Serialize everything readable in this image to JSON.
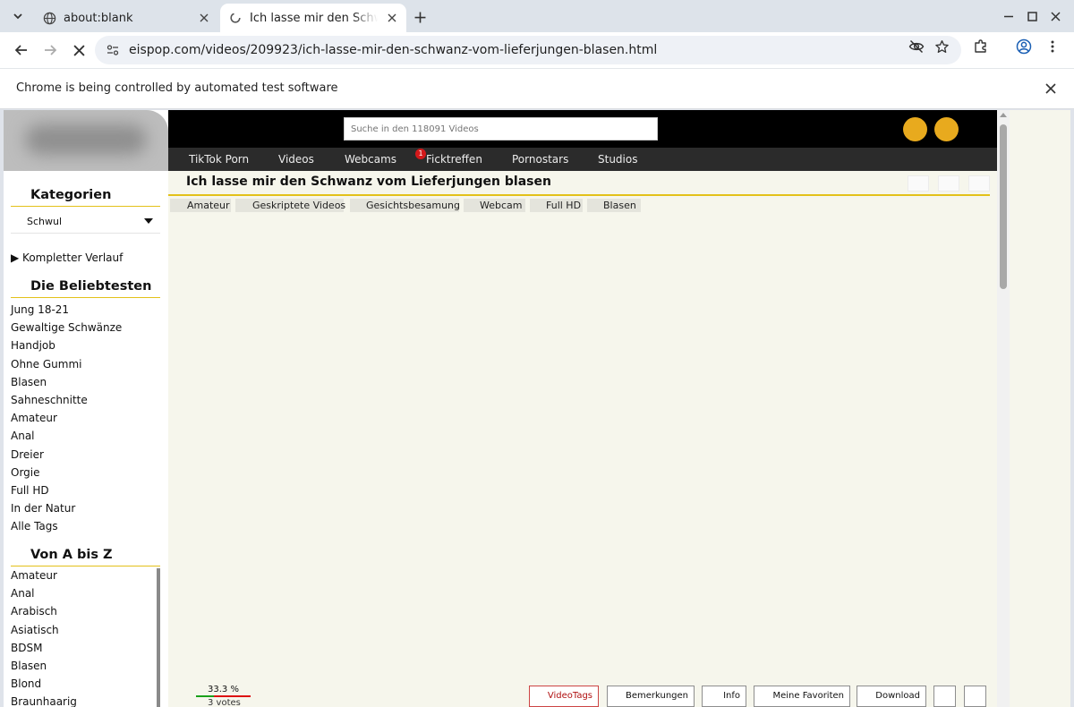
{
  "browser": {
    "tabs": [
      {
        "title": "about:blank",
        "active": false
      },
      {
        "title": "Ich lasse mir den Schwanz vom Lieferjungen blasen",
        "active": true
      }
    ],
    "url": "eispop.com/videos/209923/ich-lasse-mir-den-schwanz-vom-lieferjungen-blasen.html",
    "infobar": "Chrome is being controlled by automated test software"
  },
  "site": {
    "search_placeholder": "Suche in den 118091 Videos",
    "nav": [
      "TikTok Porn",
      "Videos",
      "Webcams",
      "Ficktreffen",
      "Pornostars",
      "Studios"
    ],
    "nav_badge": "1",
    "accent": "#e3c11a",
    "circle_color": "#e8aa1e"
  },
  "sidebar": {
    "categories_heading": "Kategorien",
    "category_selected": "Schwul",
    "history_link": "▶ Kompletter Verlauf",
    "popular_heading": "Die Beliebtesten",
    "popular": [
      "Jung 18-21",
      "Gewaltige Schwänze",
      "Handjob",
      "Ohne Gummi",
      "Blasen",
      "Sahneschnitte",
      "Amateur",
      "Anal",
      "Dreier",
      "Orgie",
      "Full HD",
      "In der Natur",
      "Alle Tags"
    ],
    "az_heading": "Von A bis Z",
    "az": [
      "Amateur",
      "Anal",
      "Arabisch",
      "Asiatisch",
      "BDSM",
      "Blasen",
      "Blond",
      "Braunhaarig"
    ]
  },
  "video": {
    "title": "Ich lasse mir den Schwanz vom Lieferjungen blasen",
    "tags": [
      "Amateur",
      "Geskriptete Videos",
      "Gesichtsbesamung",
      "Webcam",
      "Full HD",
      "Blasen"
    ],
    "rating_percent": "33.3 %",
    "rating_fraction": 0.333,
    "votes": "3 votes",
    "actions": [
      "VideoTags",
      "Bemerkungen",
      "Info",
      "Meine Favoriten",
      "Download"
    ]
  }
}
